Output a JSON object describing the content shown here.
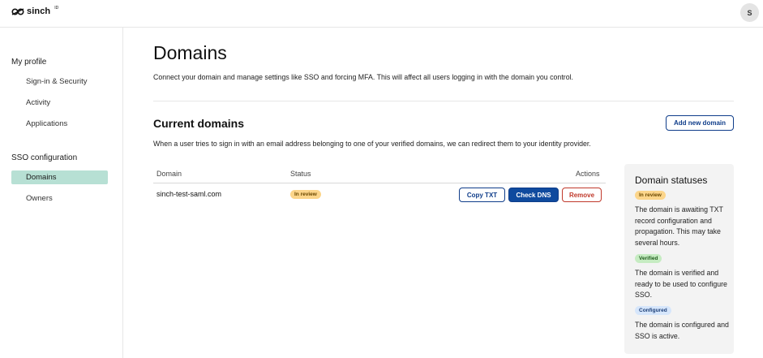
{
  "header": {
    "logo_text": "sinch",
    "logo_superscript": "ID",
    "avatar_initial": "S"
  },
  "sidebar": {
    "profile_heading": "My profile",
    "profile_items": [
      {
        "label": "Sign-in & Security"
      },
      {
        "label": "Activity"
      },
      {
        "label": "Applications"
      }
    ],
    "sso_heading": "SSO configuration",
    "sso_items": [
      {
        "label": "Domains",
        "active": true
      },
      {
        "label": "Owners",
        "active": false
      }
    ]
  },
  "main": {
    "title": "Domains",
    "description": "Connect your domain and manage settings like SSO and forcing MFA. This will affect all users logging in with the domain you control.",
    "current_domains": {
      "title": "Current domains",
      "add_button": "Add new domain",
      "description": "When a user tries to sign in with an email address belonging to one of your verified domains, we can redirect them to your identity provider."
    },
    "table": {
      "columns": [
        "Domain",
        "Status",
        "Actions"
      ],
      "rows": [
        {
          "domain": "sinch-test-saml.com",
          "status": "In review",
          "actions": {
            "copy": "Copy TXT",
            "check": "Check DNS",
            "remove": "Remove"
          }
        }
      ]
    }
  },
  "statuses_panel": {
    "title": "Domain statuses",
    "items": [
      {
        "badge": "In review",
        "text": "The domain is awaiting TXT record configuration and propagation. This may take several hours."
      },
      {
        "badge": "Verified",
        "text": "The domain is verified and ready to be used to configure SSO."
      },
      {
        "badge": "Configured",
        "text": "The domain is configured and SSO is active."
      }
    ]
  },
  "colors": {
    "primary": "#0f4a9e",
    "danger": "#c0392b",
    "active_nav": "#b7e0d4",
    "badge_review": "#fcd58a",
    "badge_verified": "#c6ecc2",
    "badge_configured": "#d6e6fb"
  }
}
